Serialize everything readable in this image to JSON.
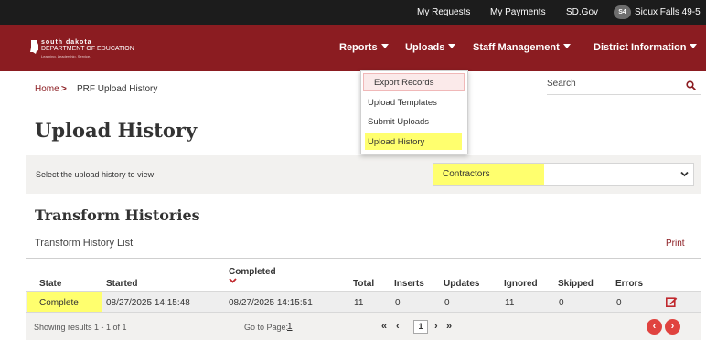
{
  "topbar": {
    "links": [
      "My Requests",
      "My Payments",
      "SD.Gov"
    ],
    "avatar_initials": "S4",
    "district": "Sioux Falls 49-5"
  },
  "logo": {
    "line1": "south dakota",
    "line2": "DEPARTMENT OF EDUCATION",
    "line3": "Learning. Leadership. Service."
  },
  "nav": {
    "items": [
      "Reports",
      "Uploads",
      "Staff Management",
      "District Information"
    ]
  },
  "uploads_menu": {
    "items": [
      "Export Records",
      "Upload Templates",
      "Submit Uploads",
      "Upload History"
    ]
  },
  "breadcrumb": {
    "home": "Home",
    "separator": ">",
    "current": "PRF Upload History"
  },
  "search": {
    "placeholder": "Search"
  },
  "page_title": "Upload History",
  "filter": {
    "label": "Select the upload history to view",
    "selected": "Contractors"
  },
  "section_title": "Transform Histories",
  "list_title": "Transform History List",
  "print_label": "Print",
  "table": {
    "headers": {
      "state": "State",
      "started": "Started",
      "completed": "Completed",
      "total": "Total",
      "inserts": "Inserts",
      "updates": "Updates",
      "ignored": "Ignored",
      "skipped": "Skipped",
      "errors": "Errors"
    },
    "rows": [
      {
        "state": "Complete",
        "started": "08/27/2025 14:15:48",
        "completed": "08/27/2025 14:15:51",
        "total": "11",
        "inserts": "0",
        "updates": "0",
        "ignored": "11",
        "skipped": "0",
        "errors": "0"
      }
    ]
  },
  "footer": {
    "showing": "Showing results 1 - 1 of 1",
    "goto_label": "Go to Page:",
    "goto_value": "1",
    "current_page": "1"
  },
  "colors": {
    "brand": "#8b1c21",
    "highlight": "#ffff6e",
    "pager_circle": "#e0433f"
  }
}
